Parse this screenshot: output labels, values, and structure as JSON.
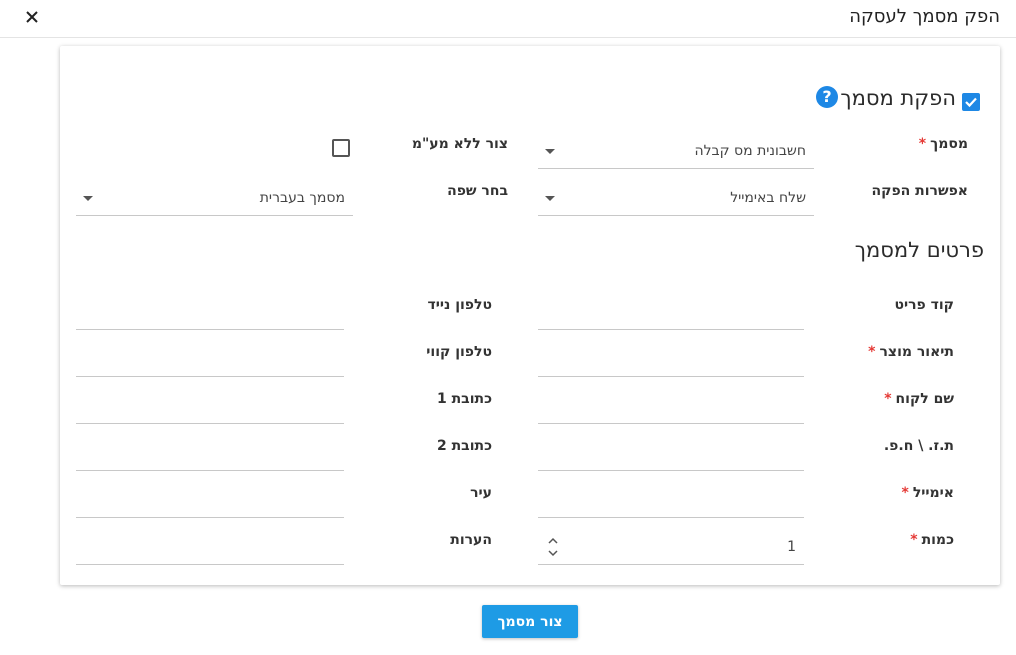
{
  "dialog": {
    "title": "הפק מסמך לעסקה",
    "close_icon": "close-icon"
  },
  "section_issue": {
    "title": "הפקת מסמך",
    "checked": true,
    "help_icon": "help-icon"
  },
  "document": {
    "label": "מסמך",
    "required_mark": "*",
    "value": "חשבונית מס קבלה"
  },
  "no_vat": {
    "label": "צור ללא מע\"מ",
    "checked": false
  },
  "issue_option": {
    "label": "אפשרות הפקה",
    "value": "שלח באימייל"
  },
  "language": {
    "label": "בחר שפה",
    "value": "מסמך בעברית"
  },
  "section_details": {
    "title": "פרטים למסמך"
  },
  "fields": {
    "item_code": {
      "label": "קוד פריט",
      "value": ""
    },
    "product_desc": {
      "label": "תיאור מוצר",
      "required_mark": "*",
      "value": ""
    },
    "customer_name": {
      "label": "שם לקוח",
      "required_mark": "*",
      "value": ""
    },
    "tax_id": {
      "label": "ת.ז. \\ ח.פ.",
      "value": ""
    },
    "email": {
      "label": "אימייל",
      "required_mark": "*",
      "value": ""
    },
    "quantity": {
      "label": "כמות",
      "required_mark": "*",
      "value": "1"
    },
    "mobile_phone": {
      "label": "טלפון נייד",
      "value": ""
    },
    "landline_phone": {
      "label": "טלפון קווי",
      "value": ""
    },
    "address1": {
      "label": "כתובת 1",
      "value": ""
    },
    "address2": {
      "label": "כתובת 2",
      "value": ""
    },
    "city": {
      "label": "עיר",
      "value": ""
    },
    "notes": {
      "label": "הערות",
      "value": ""
    }
  },
  "submit": {
    "label": "צור מסמך"
  },
  "colors": {
    "accent": "#1e88e5",
    "button": "#1e9be5",
    "required": "#e53935"
  }
}
